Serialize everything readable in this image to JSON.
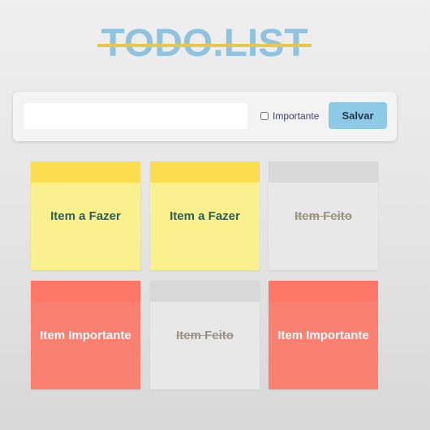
{
  "header": {
    "title": "TODO.LIST"
  },
  "form": {
    "input_value": "",
    "input_placeholder": "",
    "important_label": "Importante",
    "important_checked": false,
    "save_label": "Salvar"
  },
  "notes": [
    {
      "text": "Item a Fazer",
      "status": "todo"
    },
    {
      "text": "Item a Fazer",
      "status": "todo"
    },
    {
      "text": "Item Feito",
      "status": "done"
    },
    {
      "text": "Item Importante",
      "status": "important"
    },
    {
      "text": "Item Feito",
      "status": "done"
    },
    {
      "text": "Item Importante",
      "status": "important"
    }
  ],
  "colors": {
    "title": "#8fc3de",
    "title_strike": "#e6c84a",
    "save_button": "#8ecae6",
    "todo_header": "#fbdd4f",
    "todo_body": "#faf08e",
    "done_header": "#d8d8d8",
    "done_body": "#e8e8e8",
    "important_header": "#ff7766",
    "important_body": "#fa8072"
  }
}
